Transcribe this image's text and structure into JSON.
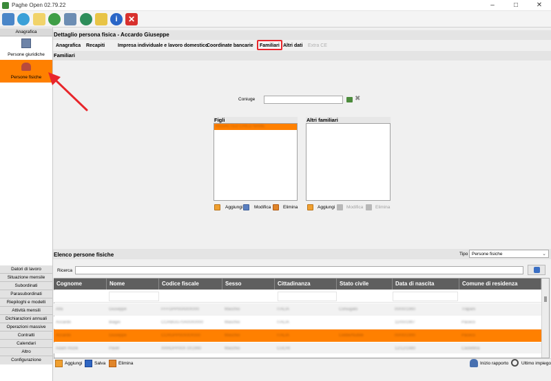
{
  "window": {
    "title": "Paghe Open 02.79.22"
  },
  "toolbar": {
    "icons": [
      "home-icon",
      "globe-icon",
      "notepad-icon",
      "help-globe-icon",
      "network-icon",
      "refresh-icon",
      "folder-icon",
      "info-icon",
      "close-red-icon"
    ]
  },
  "sidebar": {
    "header": "Anagrafica",
    "items": [
      {
        "label": "Persone giuridiche"
      },
      {
        "label": "Persone fisiche"
      }
    ],
    "bottom_buttons": [
      "Datori di lavoro",
      "Situazione mensile",
      "Subordinati",
      "Parasubordinati",
      "Riepiloghi e modelli",
      "Attività mensili",
      "Dichiarazioni annuali",
      "Operazioni massive",
      "Contratti",
      "Calendari",
      "Altro",
      "Configurazione"
    ]
  },
  "detail": {
    "title": "Dettaglio persona fisica - Accardo Giuseppe",
    "tabs": [
      "Anagrafica",
      "Recapiti",
      "Impresa individuale e lavoro domestico",
      "Coordinate bancarie",
      "Familiari",
      "Altri dati",
      "Extra CE"
    ],
    "active_tab": "Familiari",
    "subheader": "Familiari",
    "coniuge_label": "Coniuge",
    "coniuge_value": "",
    "figli": {
      "title": "Figli",
      "items": [
        "REDACTED CHILD NAME"
      ],
      "add": "Aggiungi",
      "edit": "Modifica",
      "delete": "Elimina"
    },
    "altri": {
      "title": "Altri familiari",
      "add": "Aggiungi",
      "edit": "Modifica",
      "delete": "Elimina"
    }
  },
  "elenco": {
    "title": "Elenco persone fisiche",
    "tipo_label": "Tipo",
    "tipo_value": "Persone fisiche",
    "ricerca_label": "Ricerca",
    "ricerca_value": "",
    "columns": [
      "Cognome",
      "Nome",
      "Codice fiscale",
      "Sesso",
      "Cittadinanza",
      "Stato civile",
      "Data di nascita",
      "Comune di residenza"
    ],
    "rows": [
      [
        "",
        "",
        "",
        "",
        "",
        "",
        "",
        ""
      ],
      [
        "Alfa",
        "Giuseppe",
        "FFFGPP00A00X000",
        "Maschio",
        "ITALIA",
        "Coniugato",
        "00/00/1960",
        "Trapani"
      ],
      [
        "Accardo",
        "Biagio",
        "CCRBGG70A00X0000",
        "Maschio",
        "ITALIA",
        "",
        "11/00/1997",
        "Paceco"
      ],
      [
        "Accardo",
        "Giuseppe",
        "CCRGPP00X00X000",
        "Maschio",
        "ITALIA",
        "Celibe/Nubile",
        "00/00/1990",
        "Paceco"
      ],
      [
        "Adam Rozik",
        "Pavel",
        "XRRDPP00X 0X1990",
        "Maschio",
        "CUCHI",
        "",
        "12/12/1980",
        "Castellina"
      ]
    ],
    "selected_row": 3,
    "bottom": {
      "add": "Aggiungi",
      "save": "Salva",
      "delete": "Elimina",
      "inizio": "Inizio rapporto",
      "ultimo": "Ultimo impiego"
    }
  },
  "colors": {
    "accent": "#ff8000",
    "annotation": "#e8262b"
  }
}
